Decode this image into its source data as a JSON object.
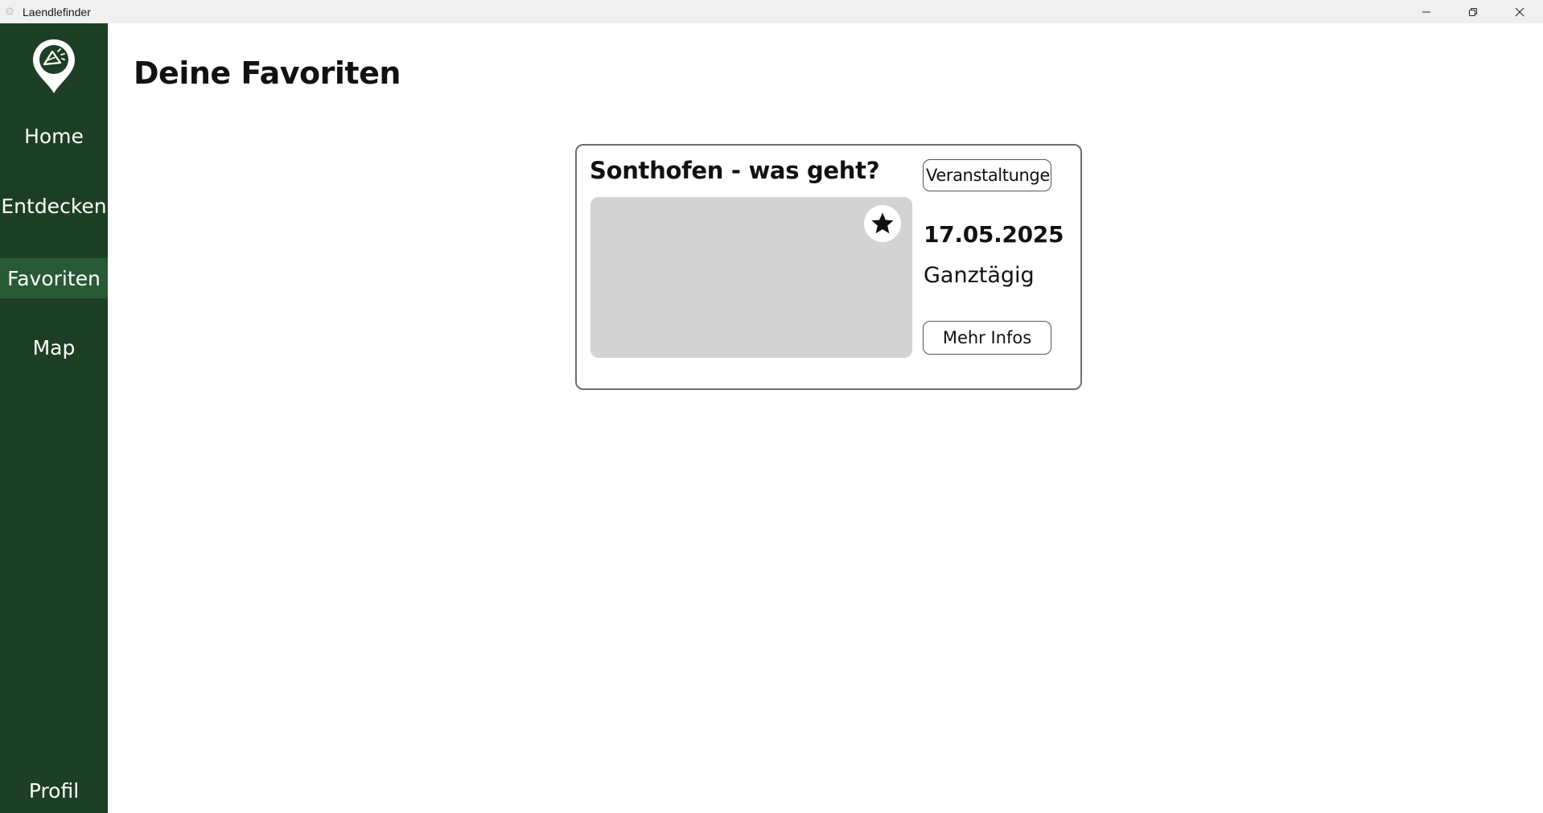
{
  "window": {
    "title": "Laendlefinder"
  },
  "sidebar": {
    "items": [
      {
        "label": "Home",
        "active": false
      },
      {
        "label": "Entdecken",
        "active": false
      },
      {
        "label": "Favoriten",
        "active": true
      },
      {
        "label": "Map",
        "active": false
      }
    ],
    "profile_label": "Profil"
  },
  "main": {
    "title": "Deine Favoriten",
    "favorites": [
      {
        "title": "Sonthofen - was geht?",
        "category": "Veranstaltungen",
        "date": "17.05.2025",
        "time": "Ganztägig",
        "info_button": "Mehr Infos",
        "favorite_icon": "star-icon",
        "is_favorite": true
      }
    ]
  },
  "colors": {
    "sidebar_bg": "#1d3f25",
    "sidebar_active_bg": "#285a35",
    "image_placeholder": "#d3d3d3",
    "card_border": "#6e6e6e"
  }
}
